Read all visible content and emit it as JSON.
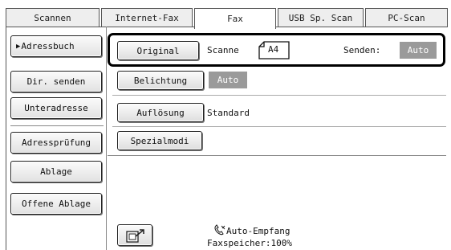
{
  "tabs": [
    {
      "label": "Scannen"
    },
    {
      "label": "Internet-Fax"
    },
    {
      "label": "Fax"
    },
    {
      "label": "USB Sp. Scan"
    },
    {
      "label": "PC-Scan"
    }
  ],
  "active_tab": "Fax",
  "sidebar": {
    "items": [
      {
        "label": "Adressbuch",
        "selected": true
      },
      {
        "label": "Dir. senden"
      },
      {
        "label": "Unteradresse"
      },
      {
        "label": "Adressprüfung"
      },
      {
        "label": "Ablage"
      },
      {
        "label": "Offene Ablage"
      }
    ]
  },
  "settings": {
    "original": {
      "label": "Original",
      "value": "Scanne",
      "paper": "A4",
      "send_label": "Senden:",
      "send_value": "Auto"
    },
    "exposure": {
      "label": "Belichtung",
      "value": "Auto"
    },
    "resolution": {
      "label": "Auflösung",
      "value": "Standard"
    },
    "special": {
      "label": "Spezialmodi"
    }
  },
  "status": {
    "auto_receive": "Auto-Empfang",
    "memory": "Faxspeicher:100%"
  },
  "icons": {
    "action_button": "document-arrow-icon",
    "status": "phone-icon",
    "selected_marker": "triangle-right-icon"
  },
  "colors": {
    "badge": "#9a9a9a",
    "highlight_border": "#000000"
  }
}
